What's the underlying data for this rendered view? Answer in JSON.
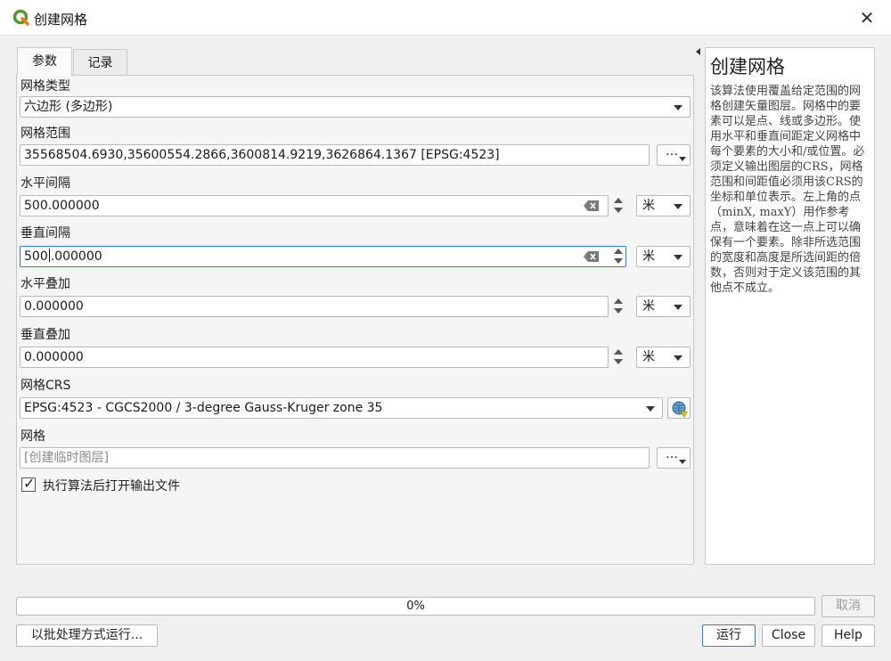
{
  "window": {
    "title": "创建网格",
    "close_glyph": "✕",
    "logo_icon": "qgis-logo-icon"
  },
  "tabs": [
    {
      "label": "参数",
      "active": true
    },
    {
      "label": "记录",
      "active": false
    }
  ],
  "params": {
    "grid_type": {
      "label": "网格类型",
      "value": "六边形 (多边形)"
    },
    "grid_extent": {
      "label": "网格范围",
      "value": "35568504.6930,35600554.2866,3600814.9219,3626864.1367 [EPSG:4523]",
      "button": "…"
    },
    "h_spacing": {
      "label": "水平间隔",
      "value": "500.000000",
      "unit": "米"
    },
    "v_spacing": {
      "label": "垂直间隔",
      "value_before_caret": "500",
      "value_after_caret": ".000000",
      "unit": "米"
    },
    "h_overlay": {
      "label": "水平叠加",
      "value": "0.000000",
      "unit": "米"
    },
    "v_overlay": {
      "label": "垂直叠加",
      "value": "0.000000",
      "unit": "米"
    },
    "grid_crs": {
      "label": "网格CRS",
      "value": "EPSG:4523 - CGCS2000 / 3-degree Gauss-Kruger zone 35"
    },
    "output": {
      "label": "网格",
      "placeholder": "[创建临时图层]",
      "button": "…"
    },
    "open_output": {
      "label": "执行算法后打开输出文件",
      "checked": true
    }
  },
  "help": {
    "title": "创建网格",
    "body": "该算法使用覆盖给定范围的网格创建矢量图层。网格中的要素可以是点、线或多边形。使用水平和垂直间距定义网格中每个要素的大小和/或位置。必须定义输出图层的CRS，网格范围和间距值必须用该CRS的坐标和单位表示。左上角的点（minX, maxY）用作参考点，意味着在这一点上可以确保有一个要素。除非所选范围的宽度和高度是所选间距的倍数，否则对于定义该范围的其他点不成立。"
  },
  "progress": {
    "percent": 0,
    "label": "0%"
  },
  "buttons": {
    "cancel": "取消",
    "batch": "以批处理方式运行...",
    "run": "运行",
    "close": "Close",
    "help": "Help"
  },
  "colors": {
    "accent": "#2f7fd6",
    "qgis_green": "#589632",
    "qgis_yellow": "#ee7913"
  }
}
